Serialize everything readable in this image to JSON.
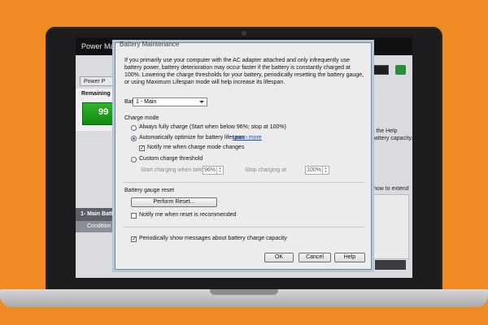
{
  "background_app": {
    "title": "Power Mana",
    "tab_label": "Power P",
    "remaining_label": "Remaining b",
    "battery_percent": "99",
    "battery_header": "1- Main Batt",
    "battery_row_label": "Condition",
    "right_text_1": "s the Help",
    "right_text_2": "battery capacity.",
    "right_text_3": "how to extend"
  },
  "dialog": {
    "title": "Battery Maintenance",
    "description": "If you primarily use your computer with the AC adapter attached and only infrequently use battery power, battery deterioration may occur faster if the battery is constantly charged at 100%. Lowering the charge thresholds for your battery, periodically resetting the battery gauge, or using Maximum Lifespan mode will help increase its lifespan.",
    "battery_label": "Battery:",
    "battery_value": "1 - Main",
    "charge_mode_label": "Charge mode",
    "option_always_full": "Always fully charge (Start when below 96%; stop at 100%)",
    "option_auto_optimize": "Automatically optimize for battery lifespan",
    "learn_more": "Learn more",
    "notify_charge_mode": "Notify me when charge mode changes",
    "option_custom": "Custom charge threshold",
    "start_below_label": "Start charging when below",
    "start_value": "96%",
    "stop_at_label": "Stop charging at",
    "stop_value": "100%",
    "gauge_reset_label": "Battery gauge reset",
    "perform_reset": "Perform Reset...",
    "notify_reset": "Notify me when reset is recommended",
    "periodic_messages": "Periodically show messages about battery charge capacity",
    "ok": "OK",
    "cancel": "Cancel",
    "help": "Help"
  },
  "state": {
    "charge_mode_selected": "auto_optimize",
    "notify_charge_mode_checked": true,
    "notify_reset_checked": false,
    "periodic_messages_checked": true
  },
  "colors": {
    "background": "#f08a24",
    "battery_green": "#1ea51e",
    "link": "#1a4fc4"
  }
}
